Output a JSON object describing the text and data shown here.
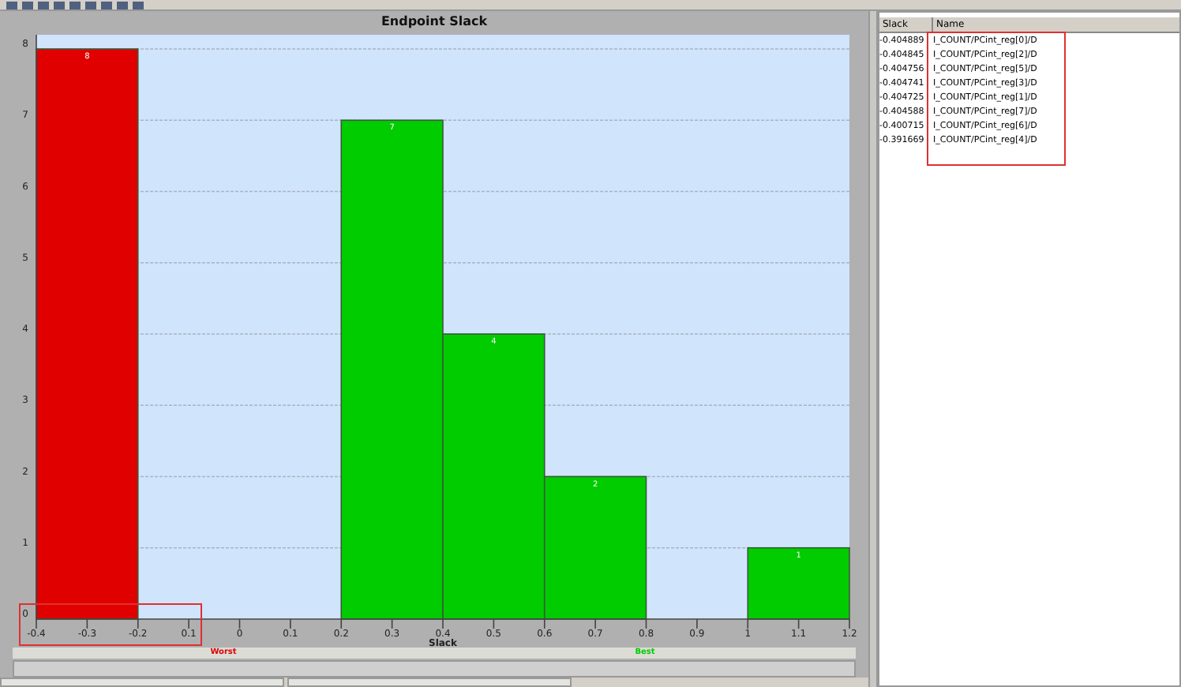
{
  "chart_panel": {
    "chart_data": {
      "type": "bar",
      "title": "Endpoint Slack",
      "xlabel": "Slack",
      "grid": true,
      "x": [
        -0.3,
        0.3,
        0.5,
        0.7,
        1.1
      ],
      "series": [
        {
          "name": "Worst",
          "color": "#e00000",
          "values": [
            8,
            null,
            null,
            null,
            null
          ]
        },
        {
          "name": "Best",
          "color": "#00cc00",
          "values": [
            null,
            7,
            4,
            2,
            1
          ]
        }
      ],
      "xlim": [
        -0.4,
        1.2
      ],
      "ylim": [
        0,
        8
      ],
      "xticks": [
        -0.4,
        -0.3,
        -0.2,
        {
          "value": -0.1,
          "label": "0.1"
        },
        0,
        0.1,
        0.2,
        0.3,
        0.4,
        0.5,
        0.6,
        0.7,
        0.8,
        0.9,
        1,
        1.1,
        1.2
      ],
      "yticks": [
        0,
        1,
        2,
        3,
        4,
        5,
        6,
        7,
        8
      ],
      "data_labels": true
    }
  },
  "endpoint_table": {
    "columns": [
      "Slack",
      "Name"
    ],
    "rows": [
      {
        "slack": "-0.404889",
        "name": "I_COUNT/PCint_reg[0]/D"
      },
      {
        "slack": "-0.404845",
        "name": "I_COUNT/PCint_reg[2]/D"
      },
      {
        "slack": "-0.404756",
        "name": "I_COUNT/PCint_reg[5]/D"
      },
      {
        "slack": "-0.404741",
        "name": "I_COUNT/PCint_reg[3]/D"
      },
      {
        "slack": "-0.404725",
        "name": "I_COUNT/PCint_reg[1]/D"
      },
      {
        "slack": "-0.404588",
        "name": "I_COUNT/PCint_reg[7]/D"
      },
      {
        "slack": "-0.400715",
        "name": "I_COUNT/PCint_reg[6]/D"
      },
      {
        "slack": "-0.391669",
        "name": "I_COUNT/PCint_reg[4]/D"
      }
    ]
  }
}
